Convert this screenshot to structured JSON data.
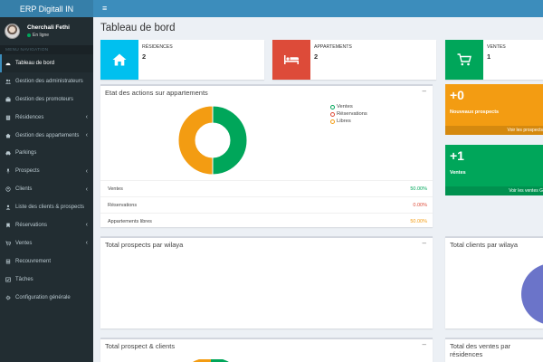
{
  "app": {
    "brand": "ERP Digitall IN"
  },
  "user": {
    "name": "Cherchali Fethi",
    "status": "En ligne"
  },
  "sidebar": {
    "header": "MENU NAVIGATION",
    "items": [
      {
        "label": "Tableau de bord",
        "icon": "dashboard-icon"
      },
      {
        "label": "Gestion des administrateurs",
        "icon": "users-icon"
      },
      {
        "label": "Gestion des promoteurs",
        "icon": "briefcase-icon"
      },
      {
        "label": "Résidences",
        "icon": "building-icon"
      },
      {
        "label": "Gestion des appartements",
        "icon": "home-icon"
      },
      {
        "label": "Parkings",
        "icon": "car-icon"
      },
      {
        "label": "Prospects",
        "icon": "pin-icon"
      },
      {
        "label": "Clients",
        "icon": "user-icon"
      },
      {
        "label": "Liste des clients & prospects",
        "icon": "user-list-icon"
      },
      {
        "label": "Réservations",
        "icon": "bookmark-icon"
      },
      {
        "label": "Ventes",
        "icon": "cart-icon"
      },
      {
        "label": "Recouvrement",
        "icon": "calculator-icon"
      },
      {
        "label": "Tâches",
        "icon": "tasks-icon"
      },
      {
        "label": "Configuration générale",
        "icon": "gear-icon"
      }
    ]
  },
  "page": {
    "title": "Tableau de bord"
  },
  "infoboxes": [
    {
      "label": "RÉSIDENCES",
      "value": "2",
      "color": "#00c0ef"
    },
    {
      "label": "APPARTEMENTS",
      "value": "2",
      "color": "#dd4b39"
    },
    {
      "label": "VENTES",
      "value": "1",
      "color": "#00a65a"
    }
  ],
  "actions_box": {
    "title": "Etat des actions sur appartements",
    "legend": [
      "Ventes",
      "Réservations",
      "Libres"
    ],
    "rows": [
      {
        "label": "Ventes",
        "value": "50.00%",
        "color": "#00a65a"
      },
      {
        "label": "Réservations",
        "value": "0.00%",
        "color": "#dd4b39"
      },
      {
        "label": "Appartements libres",
        "value": "50.00%",
        "color": "#f39c12"
      }
    ]
  },
  "chart_data": {
    "type": "pie",
    "categories": [
      "Ventes",
      "Réservations",
      "Libres"
    ],
    "values": [
      50,
      0,
      50
    ],
    "colors": [
      "#00a65a",
      "#dd4b39",
      "#f39c12"
    ],
    "legend": "top-right"
  },
  "small_boxes": [
    {
      "number": "+0",
      "label": "Nouveaux prospects",
      "footer": "Voir les prospects",
      "color": "#f39c12"
    },
    {
      "number": "+1",
      "label": "Ventes",
      "footer": "Voir les ventes G",
      "color": "#00a65a"
    }
  ],
  "boxes": {
    "prospects_wilaya": "Total prospects par wilaya",
    "clients_wilaya": "Total clients par wilaya",
    "prospect_clients": "Total prospect & clients",
    "ventes_residences": "Total des ventes par résidences"
  },
  "ui": {
    "collapse_symbol": "–",
    "menu_symbol": "≡",
    "chevron_symbol": "‹"
  }
}
